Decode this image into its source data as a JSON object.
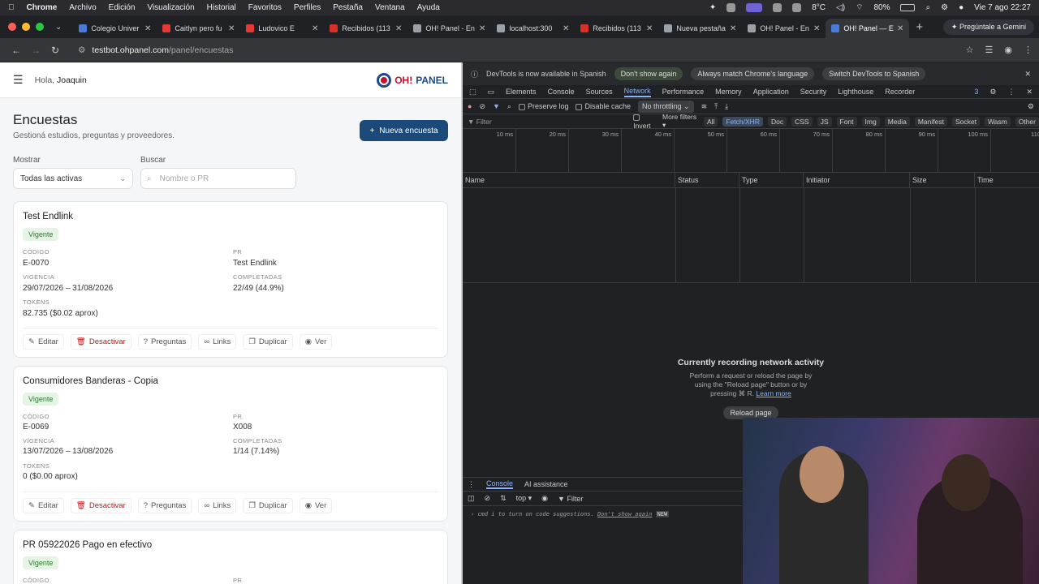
{
  "macos_menu": {
    "app": "Chrome",
    "items": [
      "Archivo",
      "Edición",
      "Visualización",
      "Historial",
      "Favoritos",
      "Perfiles",
      "Pestaña",
      "Ventana",
      "Ayuda"
    ],
    "temperature": "8°C",
    "battery": "80%",
    "clock": "Vie 7 ago  22:27"
  },
  "tabs": [
    {
      "title": "Colegio Univer",
      "fav": "#4a7ad8"
    },
    {
      "title": "Caitlyn pero fu",
      "fav": "#e53935"
    },
    {
      "title": "Ludovico E",
      "fav": "#e53935"
    },
    {
      "title": "Recibidos (113",
      "fav": "#d93025"
    },
    {
      "title": "OH! Panel - En",
      "fav": "#9aa0a6"
    },
    {
      "title": "localhost:300",
      "fav": "#9aa0a6"
    },
    {
      "title": "Recibidos (113",
      "fav": "#d93025"
    },
    {
      "title": "Nueva pestaña",
      "fav": "#9aa0a6"
    },
    {
      "title": "OH! Panel - En",
      "fav": "#9aa0a6"
    },
    {
      "title": "OH! Panel — E",
      "fav": "#4a7ad8"
    }
  ],
  "gemini_button": "Pregúntale a Gemini",
  "address": {
    "host": "testbot.ohpanel.com",
    "path": "/panel/encuestas"
  },
  "header": {
    "greeting": "Hola,",
    "user": "Joaquin",
    "logo_oh": "OH!",
    "logo_panel": "PANEL"
  },
  "page": {
    "title": "Encuestas",
    "subtitle": "Gestioná estudios, preguntas y proveedores.",
    "new_button": "Nueva encuesta",
    "show_label": "Mostrar",
    "show_value": "Todas las activas",
    "search_label": "Buscar",
    "search_placeholder": "Nombre o PR"
  },
  "field_labels": {
    "code": "CÓDIGO",
    "pr": "PR",
    "validity": "VIGENCIA",
    "completed": "COMPLETADAS",
    "tokens": "TOKENS"
  },
  "action_labels": {
    "edit": "Editar",
    "deactivate": "Desactivar",
    "questions": "Preguntas",
    "links": "Links",
    "duplicate": "Duplicar",
    "view": "Ver"
  },
  "surveys": [
    {
      "title": "Test Endlink",
      "status": "Vigente",
      "code": "E-0070",
      "pr": "Test Endlink",
      "validity": "29/07/2026 – 31/08/2026",
      "completed": "22/49 (44.9%)",
      "tokens": "82.735 ($0.02 aprox)"
    },
    {
      "title": "Consumidores Banderas - Copia",
      "status": "Vigente",
      "code": "E-0069",
      "pr": "X008",
      "validity": "13/07/2026 – 13/08/2026",
      "completed": "1/14 (7.14%)",
      "tokens": "0 ($0.00 aprox)"
    },
    {
      "title": "PR 05922026 Pago en efectivo",
      "status": "Vigente",
      "code": "",
      "pr": ""
    }
  ],
  "devtools": {
    "info": "DevTools is now available in Spanish",
    "dont_show": "Don't show again",
    "match_lang": "Always match Chrome's language",
    "switch": "Switch DevTools to Spanish",
    "tabs": [
      "Elements",
      "Console",
      "Sources",
      "Network",
      "Performance",
      "Memory",
      "Application",
      "Security",
      "Lighthouse",
      "Recorder"
    ],
    "issues": "3",
    "preserve_log": "Preserve log",
    "disable_cache": "Disable cache",
    "throttling": "No throttling",
    "filter": "Filter",
    "invert": "Invert",
    "more_filters": "More filters",
    "chips": [
      "All",
      "Fetch/XHR",
      "Doc",
      "CSS",
      "JS",
      "Font",
      "Img",
      "Media",
      "Manifest",
      "Socket",
      "Wasm",
      "Other"
    ],
    "timeline_ticks": [
      "10 ms",
      "20 ms",
      "30 ms",
      "40 ms",
      "50 ms",
      "60 ms",
      "70 ms",
      "80 ms",
      "90 ms",
      "100 ms",
      "110"
    ],
    "columns": [
      "Name",
      "Status",
      "Type",
      "Initiator",
      "Size",
      "Time"
    ],
    "recording_title": "Currently recording network activity",
    "recording_line1": "Perform a request or reload the page by",
    "recording_line2": "using the \"Reload page\" button or by",
    "recording_line3": "pressing ⌘ R.",
    "learn_more": "Learn more",
    "reload": "Reload page",
    "drawer_tabs": [
      "Console",
      "AI assistance"
    ],
    "context": "top",
    "console_filter": "Filter",
    "hint": "cmd  i  to turn on code suggestions.",
    "hint_dont": "Don't show again",
    "hint_new": "NEW"
  }
}
